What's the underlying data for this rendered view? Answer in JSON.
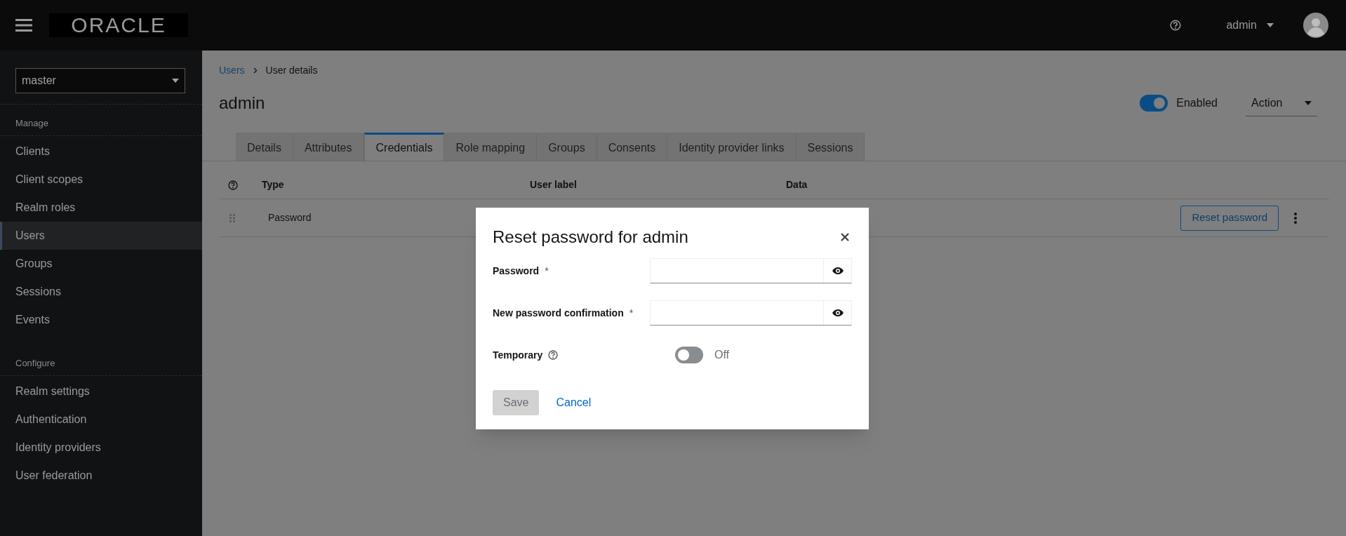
{
  "header": {
    "logo": "ORACLE",
    "user": "admin"
  },
  "sidebar": {
    "realm": "master",
    "sections": [
      {
        "title": "Manage",
        "items": [
          {
            "label": "Clients",
            "selected": false
          },
          {
            "label": "Client scopes",
            "selected": false
          },
          {
            "label": "Realm roles",
            "selected": false
          },
          {
            "label": "Users",
            "selected": true
          },
          {
            "label": "Groups",
            "selected": false
          },
          {
            "label": "Sessions",
            "selected": false
          },
          {
            "label": "Events",
            "selected": false
          }
        ]
      },
      {
        "title": "Configure",
        "items": [
          {
            "label": "Realm settings",
            "selected": false
          },
          {
            "label": "Authentication",
            "selected": false
          },
          {
            "label": "Identity providers",
            "selected": false
          },
          {
            "label": "User federation",
            "selected": false
          }
        ]
      }
    ]
  },
  "breadcrumb": [
    {
      "label": "Users",
      "kind": "link"
    },
    {
      "label": "User details",
      "kind": "current"
    }
  ],
  "page": {
    "title": "admin",
    "enabled": {
      "on": true,
      "label": "Enabled"
    },
    "action": "Action"
  },
  "tabs": [
    {
      "label": "Details",
      "selected": false
    },
    {
      "label": "Attributes",
      "selected": false
    },
    {
      "label": "Credentials",
      "selected": true
    },
    {
      "label": "Role mapping",
      "selected": false
    },
    {
      "label": "Groups",
      "selected": false
    },
    {
      "label": "Consents",
      "selected": false
    },
    {
      "label": "Identity provider links",
      "selected": false
    },
    {
      "label": "Sessions",
      "selected": false
    }
  ],
  "credentials_table": {
    "columns": [
      "Type",
      "User label",
      "Data"
    ],
    "rows": [
      {
        "type": "Password",
        "action": "Reset password"
      }
    ]
  },
  "dialog": {
    "title": "Reset password for admin",
    "fields": [
      {
        "kind": "password",
        "label": "Password",
        "marker": "*"
      },
      {
        "kind": "password",
        "label": "New password confirmation",
        "marker": "*"
      },
      {
        "kind": "toggle",
        "label": "Temporary",
        "on": false,
        "state_label": "Off"
      }
    ],
    "buttons": [
      {
        "kind": "primary",
        "label": "Save",
        "disabled": true
      },
      {
        "kind": "link",
        "label": "Cancel"
      }
    ]
  }
}
